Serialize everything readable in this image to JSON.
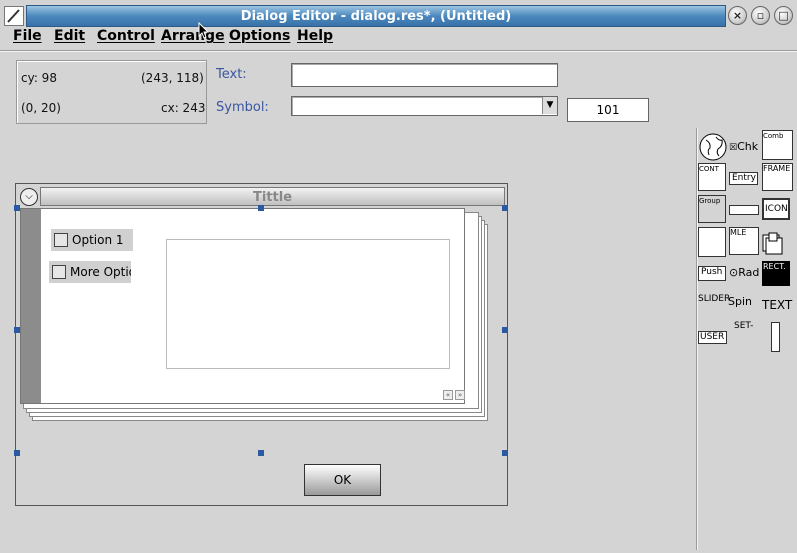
{
  "window": {
    "title": "Dialog Editor - dialog.res*, (Untitled)",
    "buttons": [
      "close-icon",
      "minimize-icon",
      "maximize-icon"
    ]
  },
  "menu": {
    "items": [
      "File",
      "Edit",
      "Control",
      "Arrange",
      "Options",
      "Help"
    ]
  },
  "coords": {
    "cy": "cy: 98",
    "pos": "(243, 118)",
    "origin": "(0, 20)",
    "cx": "cx: 243"
  },
  "props": {
    "text_label": "Text:",
    "text_value": "",
    "symbol_label": "Symbol:",
    "symbol_value": "",
    "id_value": "101"
  },
  "palette": {
    "chk": "Chk",
    "comb": "Comb",
    "cont": "CONT",
    "entry": "Entry",
    "frame": "FRAME",
    "group": "Group",
    "icon": "ICON",
    "mle": "MLE",
    "push": "Push",
    "rad": "Rad",
    "rect": "RECT.",
    "slider": "SLIDER",
    "spin": "Spin",
    "text": "TEXT",
    "user": "USER",
    "set": "SET-"
  },
  "dialog": {
    "title": "Tittle",
    "option1": "Option 1",
    "option2": "More Optio",
    "ok": "OK"
  }
}
